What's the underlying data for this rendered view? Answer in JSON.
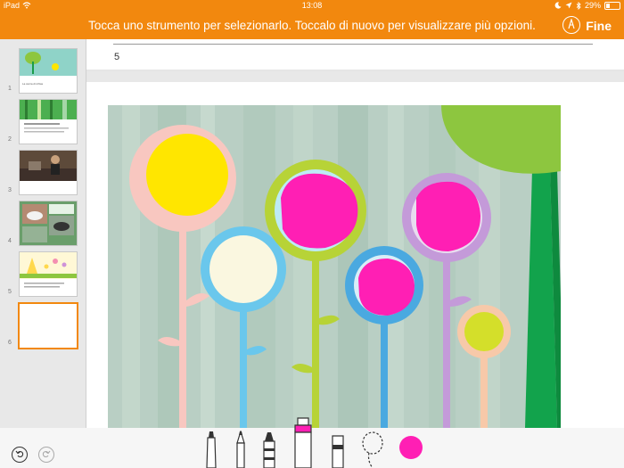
{
  "status_bar": {
    "device": "iPad",
    "time": "13:08",
    "battery": "29%"
  },
  "toolbar": {
    "message": "Tocca uno strumento per selezionarlo. Toccalo di nuovo per visualizzare più opzioni.",
    "done_label": "Fine",
    "pen_icon": "pen-circle-icon"
  },
  "slides": [
    {
      "number": "1",
      "title": "La storia di ichlas"
    },
    {
      "number": "2"
    },
    {
      "number": "3"
    },
    {
      "number": "4"
    },
    {
      "number": "5"
    },
    {
      "number": "6",
      "selected": true
    }
  ],
  "notes": {
    "text": "5"
  },
  "drawing_tools": {
    "tools": [
      "marker",
      "pencil",
      "crayon",
      "highlighter",
      "eraser",
      "lasso"
    ],
    "selected_tool": "highlighter",
    "selected_color": "#ff1fb4"
  },
  "colors": {
    "accent": "#f2880e",
    "background": "#e6e6e6"
  }
}
